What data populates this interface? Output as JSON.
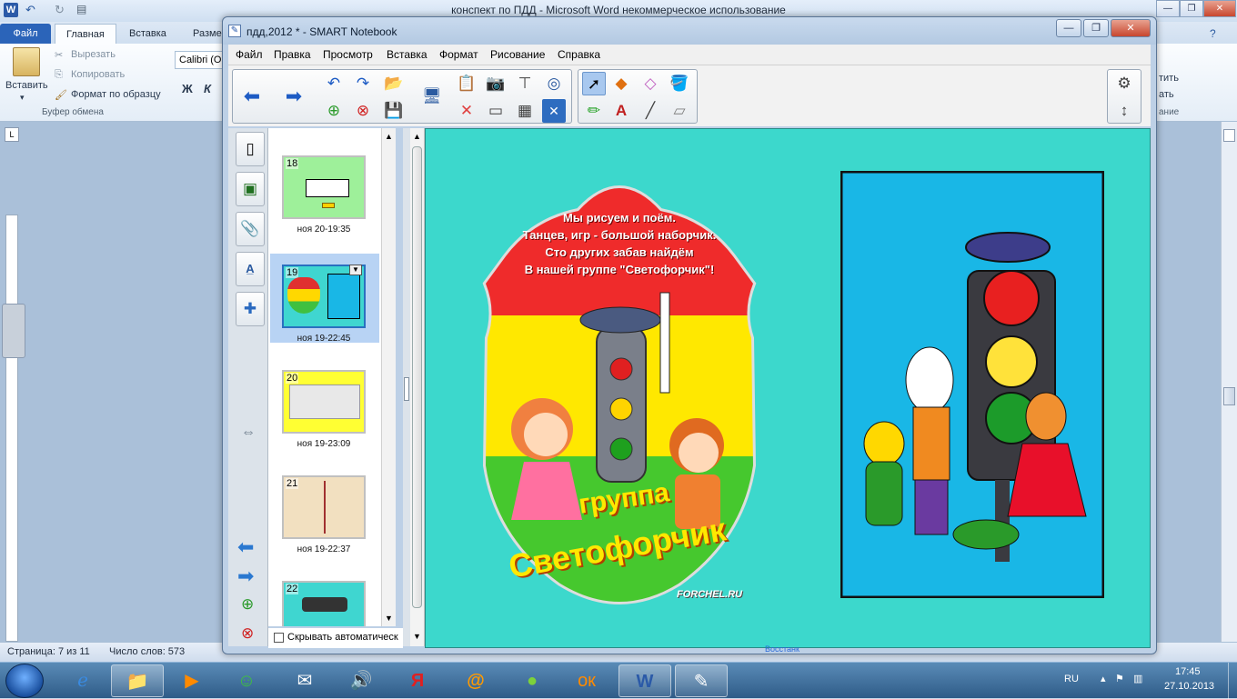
{
  "word": {
    "title": "конспект по ПДД  -  Microsoft Word некоммерческое использование",
    "tabs": [
      "Файл",
      "Главная",
      "Вставка",
      "Разме"
    ],
    "right_tabs_clip": [
      "тить",
      "ать",
      "ание"
    ],
    "clipboard": {
      "paste": "Вставить",
      "cut": "Вырезать",
      "copy": "Копировать",
      "format_painter": "Формат по образцу",
      "group_label": "Буфер обмена"
    },
    "font_name": "Calibri (О",
    "bold": "Ж",
    "italic": "К",
    "status": {
      "page": "Страница: 7 из 11",
      "words": "Число слов: 573"
    }
  },
  "smart": {
    "title": "пдд,2012 * - SMART Notebook",
    "menu": [
      "Файл",
      "Правка",
      "Просмотр",
      "Вставка",
      "Формат",
      "Рисование",
      "Справка"
    ],
    "slides": [
      {
        "num": "18",
        "label": "ноя 20-19:35",
        "color": "#9ef09a"
      },
      {
        "num": "19",
        "label": "ноя 19-22:45",
        "color": "#3fd6d0"
      },
      {
        "num": "20",
        "label": "ноя 19-23:09",
        "color": "#ffff33"
      },
      {
        "num": "21",
        "label": "ноя 19-22:37",
        "color": "#f2e0c0"
      },
      {
        "num": "22",
        "label": "",
        "color": "#3fd6d0"
      }
    ],
    "autohide": "Скрывать автоматическ",
    "canvas": {
      "background": "#3cd8cc",
      "poem": [
        "Мы рисуем и поём.",
        "Танцев, игр - большой наборчик.",
        "Сто других забав найдём",
        "В нашей группе \"Светофорчик\"!"
      ],
      "group_word": "группа",
      "group_name": "Светофорчик",
      "watermark": "FORCHEL.RU",
      "caption": "Восстанк"
    }
  },
  "taskbar": {
    "lang": "RU",
    "time": "17:45",
    "date": "27.10.2013",
    "pinned": [
      "ie-icon",
      "explorer-icon",
      "media-player-icon",
      "messenger-icon",
      "mail-icon",
      "volume-icon",
      "yandex-icon",
      "mailru-icon",
      "odnoklassniki-icon",
      "word-icon",
      "smart-notebook-icon"
    ]
  }
}
